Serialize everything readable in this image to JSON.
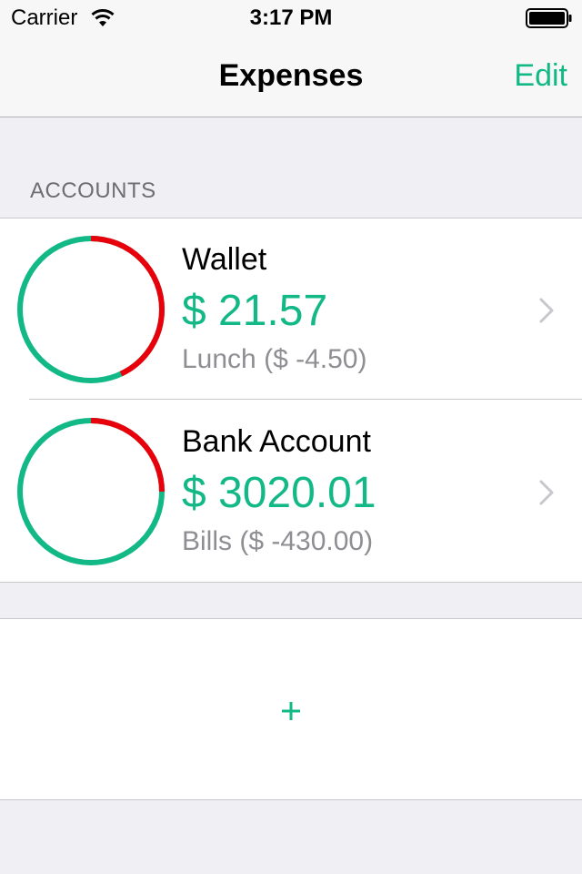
{
  "status_bar": {
    "carrier": "Carrier",
    "time": "3:17 PM",
    "icons": [
      "wifi-icon",
      "battery-icon"
    ]
  },
  "nav": {
    "title": "Expenses",
    "edit_label": "Edit"
  },
  "section": {
    "header": "ACCOUNTS"
  },
  "accounts": [
    {
      "name": "Wallet",
      "balance": "$ 21.57",
      "last_transaction": "Lunch ($ -4.50)",
      "spent_fraction": 0.43
    },
    {
      "name": "Bank Account",
      "balance": "$ 3020.01",
      "last_transaction": "Bills ($ -430.00)",
      "spent_fraction": 0.25
    }
  ],
  "add_button": {
    "icon": "plus-icon"
  },
  "colors": {
    "accent": "#12b886",
    "spent": "#e8000b",
    "background": "#efeff4",
    "secondary_text": "#8e8e93"
  }
}
